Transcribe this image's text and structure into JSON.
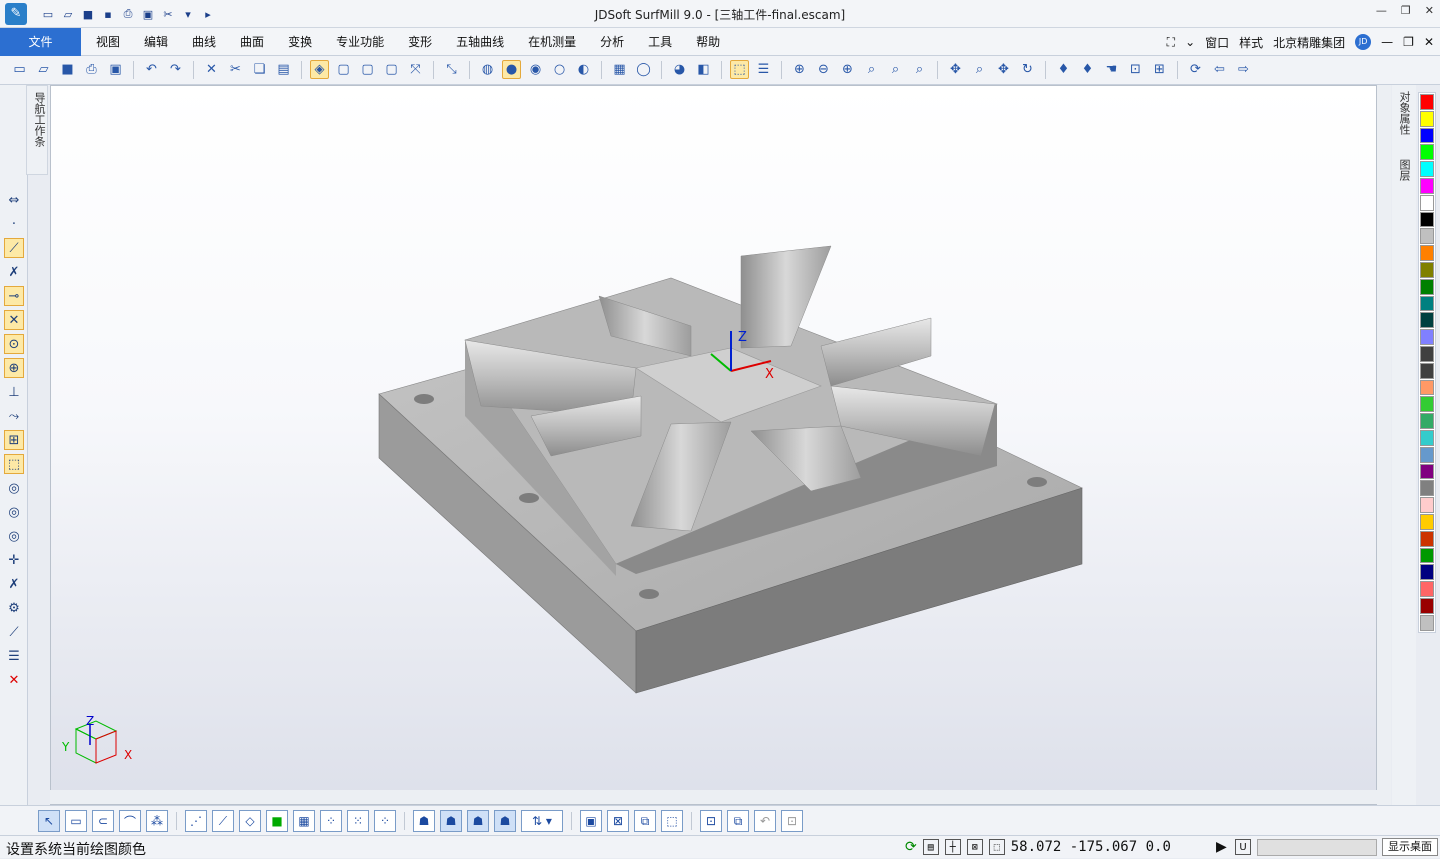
{
  "window": {
    "title": "JDSoft SurfMill 9.0 - [三轴工件-final.escam]",
    "app_icon": "JD-icon"
  },
  "menu": {
    "file": "文件",
    "items": [
      "视图",
      "编辑",
      "曲线",
      "曲面",
      "变换",
      "专业功能",
      "变形",
      "五轴曲线",
      "在机测量",
      "分析",
      "工具",
      "帮助"
    ],
    "right": {
      "window": "窗口",
      "style": "样式",
      "company": "北京精雕集团",
      "badge": "JD"
    }
  },
  "panels": {
    "left_tab": "导航工作条",
    "right_tab_1": "对象属性",
    "right_tab_2": "图层"
  },
  "viewport": {
    "axis_z": "Z",
    "axis_x": "X",
    "triad_x": "X",
    "triad_y": "Y",
    "triad_z": "Z"
  },
  "status": {
    "message": "设置系统当前绘图颜色",
    "coordinates": "58.072 -175.067 0.0",
    "show_desktop": "显示桌面",
    "mode": "U"
  },
  "palette": [
    "#ff0000",
    "#ffff00",
    "#0000ff",
    "#00ff00",
    "#00ffff",
    "#ff00ff",
    "#ffffff",
    "#000000",
    "#c0c0c0",
    "#ff8000",
    "#808000",
    "#008000",
    "#008080",
    "#004040",
    "#8080ff",
    "#404040",
    "#404040",
    "#ff9966",
    "#33cc33",
    "#33aa66",
    "#33cccc",
    "#6699cc",
    "#800080",
    "#808080",
    "#ffcccc",
    "#ffcc00",
    "#cc3300",
    "#009900",
    "#000080",
    "#ff6666",
    "#990000",
    "#c0c0c0"
  ]
}
